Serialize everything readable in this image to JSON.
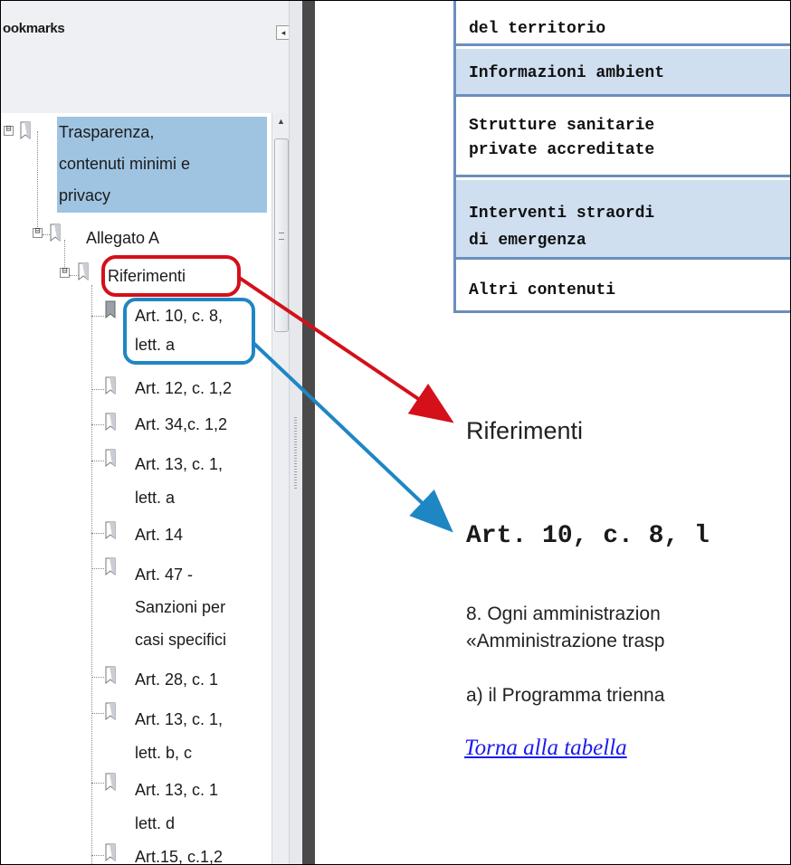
{
  "bookmarks_panel": {
    "title": "ookmarks",
    "collapse_glyph": "◂",
    "options_glyph": "⋮▾",
    "toolbar_icons": [
      "delete-bookmark-icon",
      "new-bookmark-icon",
      "expand-bookmark-icon"
    ],
    "tree": [
      {
        "label_lines": [
          "Trasparenza,",
          "contenuti minimi e",
          "privacy"
        ],
        "selected": true,
        "expander": "⊟"
      },
      {
        "label_lines": [
          "Allegato A"
        ],
        "expander": "⊟"
      },
      {
        "label_lines": [
          "Riferimenti"
        ],
        "expander": "⊟",
        "annotation": "red"
      },
      {
        "label_lines": [
          "Art. 10, c. 8,",
          "lett. a"
        ],
        "annotation": "blue"
      },
      {
        "label_lines": [
          "Art. 12, c. 1,2"
        ]
      },
      {
        "label_lines": [
          "Art. 34,c. 1,2"
        ]
      },
      {
        "label_lines": [
          "Art. 13, c. 1,",
          "lett. a"
        ]
      },
      {
        "label_lines": [
          "Art. 14"
        ]
      },
      {
        "label_lines": [
          "Art. 47 -",
          "Sanzioni per",
          "casi specifici"
        ]
      },
      {
        "label_lines": [
          "Art. 28, c. 1"
        ]
      },
      {
        "label_lines": [
          "Art. 13, c. 1,",
          "lett. b, c"
        ]
      },
      {
        "label_lines": [
          "Art. 13, c. 1",
          "lett. d"
        ]
      },
      {
        "label_lines": [
          "Art.15, c.1,2"
        ]
      }
    ]
  },
  "document": {
    "table_rows": [
      {
        "lines": [
          "del territorio"
        ],
        "alt": false
      },
      {
        "lines": [
          "Informazioni ambient"
        ],
        "alt": true
      },
      {
        "lines": [
          "Strutture sanitarie",
          "private accreditate"
        ],
        "alt": false
      },
      {
        "lines": [
          "Interventi straordi",
          "di emergenza"
        ],
        "alt": true
      },
      {
        "lines": [
          "Altri contenuti"
        ],
        "alt": false
      }
    ],
    "section_heading": "Riferimenti",
    "article_heading": "Art. 10, c. 8, l",
    "paragraph_lines": [
      "8. Ogni amministrazion",
      "«Amministrazione trasp"
    ],
    "item_line": "a) il Programma trienna",
    "back_link": "Torna alla tabella"
  },
  "colors": {
    "selection": "#9fc4e2",
    "table_border": "#6c8ebf",
    "table_alt_row": "#cfdff0",
    "annotation_red": "#d4101a",
    "annotation_blue": "#1f86c4",
    "link": "#1a1aee"
  }
}
